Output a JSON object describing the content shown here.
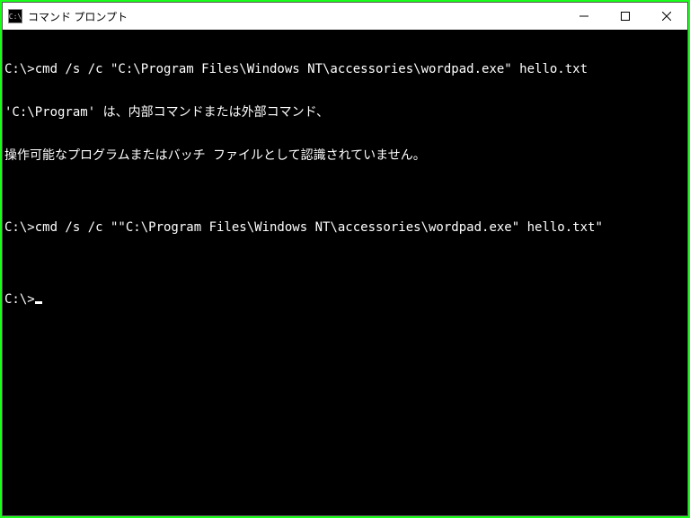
{
  "window": {
    "title": "コマンド プロンプト",
    "icon_label": "C:\\"
  },
  "terminal": {
    "lines": [
      "C:\\>cmd /s /c \"C:\\Program Files\\Windows NT\\accessories\\wordpad.exe\" hello.txt",
      "'C:\\Program' は、内部コマンドまたは外部コマンド、",
      "操作可能なプログラムまたはバッチ ファイルとして認識されていません。",
      "",
      "C:\\>cmd /s /c \"\"C:\\Program Files\\Windows NT\\accessories\\wordpad.exe\" hello.txt\"",
      "",
      "C:\\>"
    ]
  }
}
